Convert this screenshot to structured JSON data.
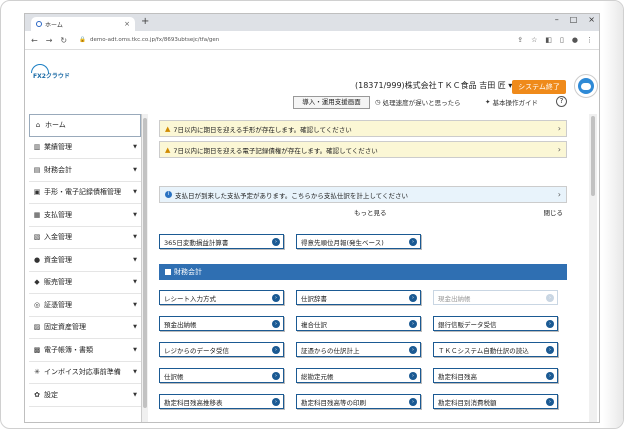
{
  "browser": {
    "tab_title": "ホーム",
    "url": "demo-adt.oms.tkc.co.jp/fx/8693ubtsejc/tfa/gen"
  },
  "header": {
    "logo_text": "FX2クラウド",
    "company": "(18371/999)株式会社ＴＫＣ食品  吉田  匠  ▾",
    "shutdown_label": "システム終了",
    "support_button": "導入・運用支援画面",
    "slow_link": "処理速度が遅いと思ったら",
    "guide_link": "基本操作ガイド",
    "help": "?"
  },
  "sidebar": {
    "items": [
      {
        "icon": "home-icon",
        "glyph": "⌂",
        "label": "ホーム",
        "caret": ""
      },
      {
        "icon": "chart-icon",
        "glyph": "▥",
        "label": "業績管理",
        "caret": "▼"
      },
      {
        "icon": "ledger-icon",
        "glyph": "▤",
        "label": "財務会計",
        "caret": "▼"
      },
      {
        "icon": "note-icon",
        "glyph": "▣",
        "label": "手形・電子記録債権管理",
        "caret": "▼"
      },
      {
        "icon": "payment-icon",
        "glyph": "▦",
        "label": "支払管理",
        "caret": "▼"
      },
      {
        "icon": "deposit-icon",
        "glyph": "▧",
        "label": "入金管理",
        "caret": "▼"
      },
      {
        "icon": "funds-icon",
        "glyph": "●",
        "label": "資金管理",
        "caret": "▼"
      },
      {
        "icon": "sales-icon",
        "glyph": "◆",
        "label": "販売管理",
        "caret": "▼"
      },
      {
        "icon": "voucher-icon",
        "glyph": "◎",
        "label": "証憑管理",
        "caret": "▼"
      },
      {
        "icon": "asset-icon",
        "glyph": "▨",
        "label": "固定資産管理",
        "caret": "▼"
      },
      {
        "icon": "book-icon",
        "glyph": "▩",
        "label": "電子帳簿・書類",
        "caret": "▼"
      },
      {
        "icon": "invoice-icon",
        "glyph": "✳",
        "label": "インボイス対応事前準備",
        "caret": "▼"
      },
      {
        "icon": "gear-icon",
        "glyph": "✿",
        "label": "設定",
        "caret": "▼"
      }
    ]
  },
  "notices": [
    {
      "type": "warn",
      "text": "7日以内に期日を迎える手形が存在します。確認してください"
    },
    {
      "type": "warn",
      "text": "7日以内に期日を迎える電子記録債権が存在します。確認してください"
    },
    {
      "type": "info",
      "text": "支払日が到来した支払予定があります。こちらから支払仕訳を計上してください"
    }
  ],
  "more_label": "もっと見る",
  "close_label": "閉じる",
  "top_buttons": [
    {
      "label": "365日変動損益計算書",
      "disabled": false
    },
    {
      "label": "得意先順位月報(発生ベース)",
      "disabled": false
    }
  ],
  "section_title": "財務会計",
  "section_buttons": [
    {
      "label": "レシート入力方式",
      "disabled": false
    },
    {
      "label": "仕訳辞書",
      "disabled": false
    },
    {
      "label": "現金出納帳",
      "disabled": true
    },
    {
      "label": "預金出納帳",
      "disabled": false
    },
    {
      "label": "複合仕訳",
      "disabled": false
    },
    {
      "label": "銀行信販データ受信",
      "disabled": false
    },
    {
      "label": "レジからのデータ受信",
      "disabled": false
    },
    {
      "label": "証憑からの仕訳計上",
      "disabled": false
    },
    {
      "label": "ＴＫＣシステム自動仕訳の読込",
      "disabled": false
    },
    {
      "label": "仕訳帳",
      "disabled": false
    },
    {
      "label": "総勘定元帳",
      "disabled": false
    },
    {
      "label": "勘定科目残高",
      "disabled": false
    },
    {
      "label": "勘定科目残高推移表",
      "disabled": false
    },
    {
      "label": "勘定科目残高等の印刷",
      "disabled": false
    },
    {
      "label": "勘定科目別消費税額",
      "disabled": false
    }
  ]
}
